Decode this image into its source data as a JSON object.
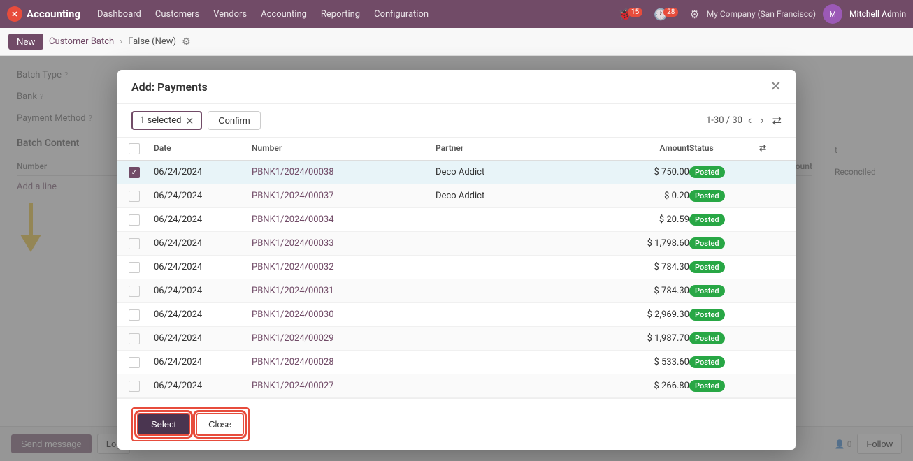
{
  "app": {
    "logo_text": "X",
    "app_name": "Accounting"
  },
  "topnav": {
    "links": [
      "Dashboard",
      "Customers",
      "Vendors",
      "Accounting",
      "Reporting",
      "Configuration"
    ],
    "company": "My Company (San Francisco)",
    "user": "Mitchell Admin",
    "notifications_1": "15",
    "notifications_2": "28"
  },
  "subnav": {
    "new_label": "New",
    "breadcrumb_parent": "Customer Batch",
    "breadcrumb_current": "False (New)"
  },
  "form": {
    "batch_type_label": "Batch Type",
    "bank_label": "Bank",
    "payment_method_label": "Payment Method",
    "batch_content_label": "Batch Content",
    "number_col": "Number",
    "amount_col": "Amount",
    "add_line_label": "Add a line"
  },
  "bottombar": {
    "send_message_label": "Send message",
    "log_label": "Log",
    "follow_label": "Follow",
    "followers_count": "0"
  },
  "modal": {
    "title": "Add: Payments",
    "selected_count": "1 selected",
    "confirm_label": "Confirm",
    "pagination": "1-30 / 30",
    "columns": {
      "date": "Date",
      "number": "Number",
      "partner": "Partner",
      "amount": "Amount",
      "status": "Status"
    },
    "rows": [
      {
        "date": "06/24/2024",
        "number": "PBNK1/2024/00038",
        "partner": "Deco Addict",
        "amount": "$ 750.00",
        "status": "Posted",
        "selected": true
      },
      {
        "date": "06/24/2024",
        "number": "PBNK1/2024/00037",
        "partner": "Deco Addict",
        "amount": "$ 0.20",
        "status": "Posted",
        "selected": false
      },
      {
        "date": "06/24/2024",
        "number": "PBNK1/2024/00034",
        "partner": "",
        "amount": "$ 20.59",
        "status": "Posted",
        "selected": false
      },
      {
        "date": "06/24/2024",
        "number": "PBNK1/2024/00033",
        "partner": "",
        "amount": "$ 1,798.60",
        "status": "Posted",
        "selected": false
      },
      {
        "date": "06/24/2024",
        "number": "PBNK1/2024/00032",
        "partner": "",
        "amount": "$ 784.30",
        "status": "Posted",
        "selected": false
      },
      {
        "date": "06/24/2024",
        "number": "PBNK1/2024/00031",
        "partner": "",
        "amount": "$ 784.30",
        "status": "Posted",
        "selected": false
      },
      {
        "date": "06/24/2024",
        "number": "PBNK1/2024/00030",
        "partner": "",
        "amount": "$ 2,969.30",
        "status": "Posted",
        "selected": false
      },
      {
        "date": "06/24/2024",
        "number": "PBNK1/2024/00029",
        "partner": "",
        "amount": "$ 1,987.70",
        "status": "Posted",
        "selected": false
      },
      {
        "date": "06/24/2024",
        "number": "PBNK1/2024/00028",
        "partner": "",
        "amount": "$ 533.60",
        "status": "Posted",
        "selected": false
      },
      {
        "date": "06/24/2024",
        "number": "PBNK1/2024/00027",
        "partner": "",
        "amount": "$ 266.80",
        "status": "Posted",
        "selected": false
      }
    ],
    "select_label": "Select",
    "close_label": "Close"
  }
}
